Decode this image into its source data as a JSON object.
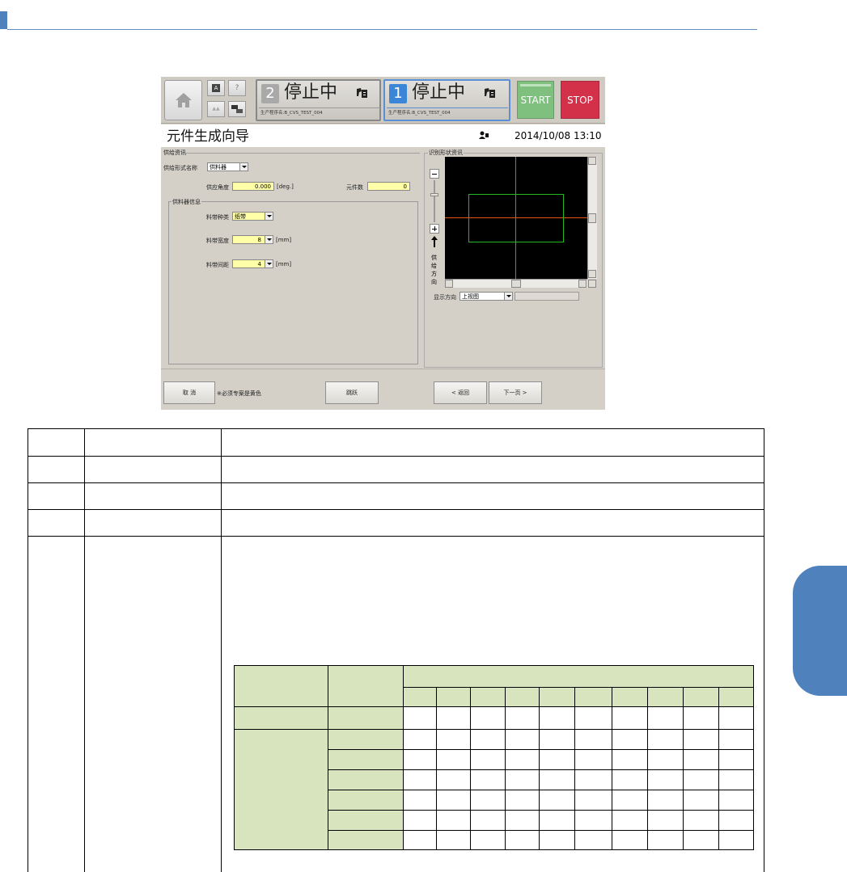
{
  "ui": {
    "panels": [
      {
        "number": "2",
        "status": "停止中",
        "program_label": "生产程序名:B_CVS_TEST_004"
      },
      {
        "number": "1",
        "status": "停止中",
        "program_label": "生产程序名:B_CVS_TEST_004"
      }
    ],
    "start_label": "START",
    "stop_label": "STOP",
    "wizard_title": "元件生成向导",
    "datetime": "2014/10/08 13:10",
    "supply": {
      "section_label": "供给资讯",
      "form_name_label": "供给形式名称",
      "form_name_value": "供料器",
      "angle_label": "供应角度",
      "angle_value": "0.000",
      "angle_unit": "[deg.]",
      "count_label": "元件数",
      "count_value": "0"
    },
    "feeder": {
      "section_label": "供料器信息",
      "tape_type_label": "料带种类",
      "tape_type_value": "纸带",
      "tape_width_label": "料带宽度",
      "tape_width_value": "8",
      "tape_width_unit": "[mm]",
      "tape_pitch_label": "料带间距",
      "tape_pitch_value": "4",
      "tape_pitch_unit": "[mm]"
    },
    "shape": {
      "section_label": "识别形状资讯",
      "feed_direction_chars": [
        "供",
        "给",
        "方",
        "向"
      ],
      "display_dir_label": "显示方向",
      "display_dir_value": "上视图"
    },
    "footer": {
      "cancel_label": "取 消",
      "note": "※必须专案是黄色",
      "skip_label": "跳跃",
      "back_label": "< 返回",
      "next_label": "下一页 >"
    }
  },
  "colors": {
    "accent": "#4f81bd",
    "start_green": "#7fc07f",
    "stop_red": "#d3304a",
    "required_yellow": "#ffffa8",
    "table_green": "#d7e4bd"
  }
}
